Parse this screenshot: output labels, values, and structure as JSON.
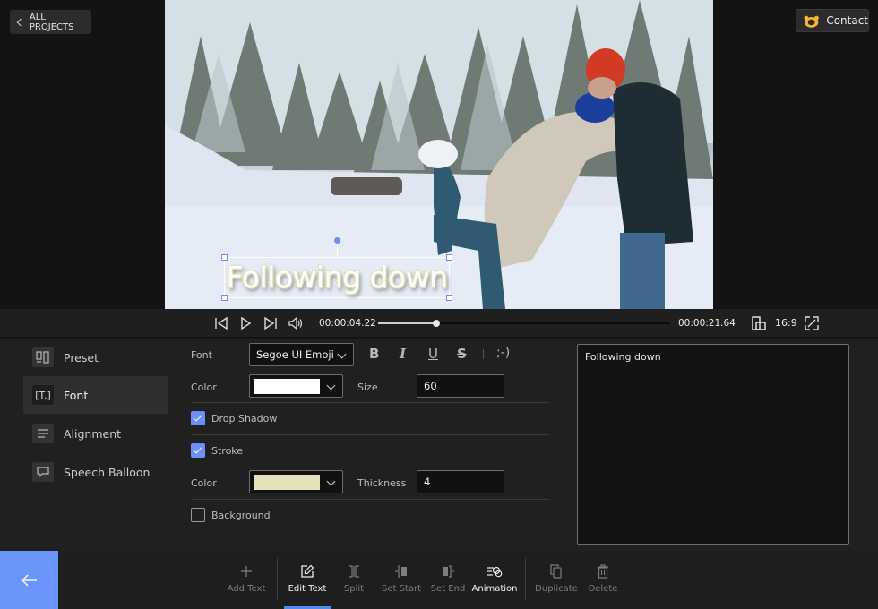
{
  "header": {
    "back_label": "ALL PROJECTS",
    "contact_label": "Contact"
  },
  "video": {
    "overlay_text": "Following down",
    "text_color": "#ffffff",
    "stroke_color": "#e3e2b8"
  },
  "transport": {
    "current_time": "00:00:04.22",
    "total_time": "00:00:21.64",
    "progress": 0.2,
    "aspect_ratio": "16:9",
    "icons": [
      "skip-back-icon",
      "play-icon",
      "skip-forward-icon",
      "volume-icon",
      "aspect-ratio-icon",
      "fullscreen-icon"
    ]
  },
  "sidebar": {
    "items": [
      {
        "label": "Preset",
        "icon": "preset-icon",
        "active": false
      },
      {
        "label": "Font",
        "icon": "font-icon",
        "active": true
      },
      {
        "label": "Alignment",
        "icon": "alignment-icon",
        "active": false
      },
      {
        "label": "Speech Balloon",
        "icon": "speech-balloon-icon",
        "active": false
      }
    ]
  },
  "font_panel": {
    "font_label": "Font",
    "font_value": "Segoe UI Emoji",
    "format_buttons": {
      "bold": "B",
      "italic": "I",
      "underline": "U",
      "strike": "S",
      "emoji": ";-)"
    },
    "color_label": "Color",
    "color_value": "#ffffff",
    "size_label": "Size",
    "size_value": "60",
    "drop_shadow_label": "Drop Shadow",
    "drop_shadow_checked": true,
    "stroke_label": "Stroke",
    "stroke_checked": true,
    "stroke_color_label": "Color",
    "stroke_color_value": "#e3e2b8",
    "thickness_label": "Thickness",
    "thickness_value": "4",
    "background_label": "Background",
    "background_checked": false
  },
  "text_editor": {
    "value": "Following down"
  },
  "toolbar": {
    "back_icon": "arrow-left-icon",
    "accent": "#6b95fb",
    "items": [
      {
        "label": "Add Text",
        "icon": "plus-icon",
        "enabled": false
      },
      {
        "label": "Edit Text",
        "icon": "edit-icon",
        "enabled": true,
        "active": true
      },
      {
        "label": "Split",
        "icon": "split-icon",
        "enabled": false
      },
      {
        "label": "Set Start",
        "icon": "set-start-icon",
        "enabled": false
      },
      {
        "label": "Set End",
        "icon": "set-end-icon",
        "enabled": false
      },
      {
        "label": "Animation",
        "icon": "animation-icon",
        "enabled": true
      },
      {
        "label": "Duplicate",
        "icon": "duplicate-icon",
        "enabled": false
      },
      {
        "label": "Delete",
        "icon": "trash-icon",
        "enabled": false
      }
    ]
  }
}
